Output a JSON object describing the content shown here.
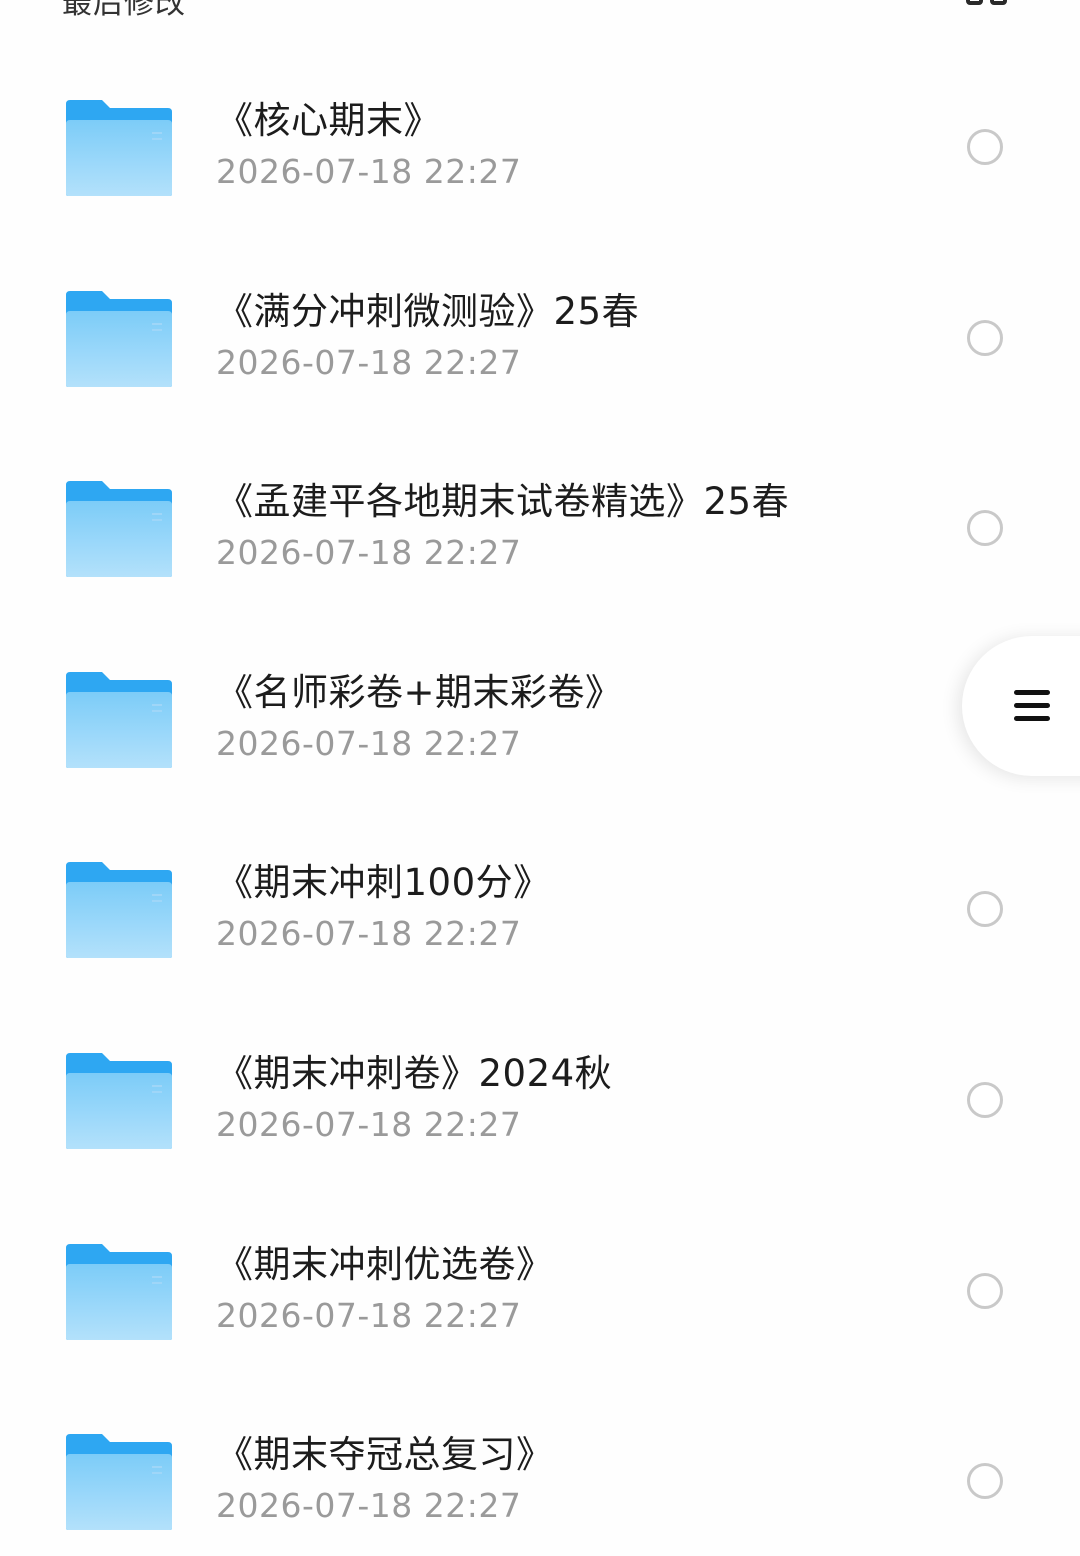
{
  "header": {
    "title": "最后修改",
    "view_toggle_icon": "grid-view-icon"
  },
  "files": [
    {
      "name": "《核心期末》",
      "date": "2026-07-18 22:27",
      "icon": "folder-icon",
      "selected": false
    },
    {
      "name": "《满分冲刺微测验》25春",
      "date": "2026-07-18 22:27",
      "icon": "folder-icon",
      "selected": false
    },
    {
      "name": "《孟建平各地期末试卷精选》25春",
      "date": "2026-07-18 22:27",
      "icon": "folder-icon",
      "selected": false
    },
    {
      "name": "《名师彩卷+期末彩卷》",
      "date": "2026-07-18 22:27",
      "icon": "folder-icon",
      "selected": false
    },
    {
      "name": "《期末冲刺100分》",
      "date": "2026-07-18 22:27",
      "icon": "folder-icon",
      "selected": false
    },
    {
      "name": "《期末冲刺卷》2024秋",
      "date": "2026-07-18 22:27",
      "icon": "folder-icon",
      "selected": false
    },
    {
      "name": "《期末冲刺优选卷》",
      "date": "2026-07-18 22:27",
      "icon": "folder-icon",
      "selected": false
    },
    {
      "name": "《期末夺冠总复习》",
      "date": "2026-07-18 22:27",
      "icon": "folder-icon",
      "selected": false
    }
  ],
  "floating_button": {
    "icon": "hamburger-menu-icon"
  },
  "colors": {
    "folder_back": "#2ea7f2",
    "folder_front_top": "#7cccf8",
    "folder_front_bottom": "#b3e1fb",
    "date_text": "#9a9a9a",
    "radio_border": "#c9c9c9"
  }
}
